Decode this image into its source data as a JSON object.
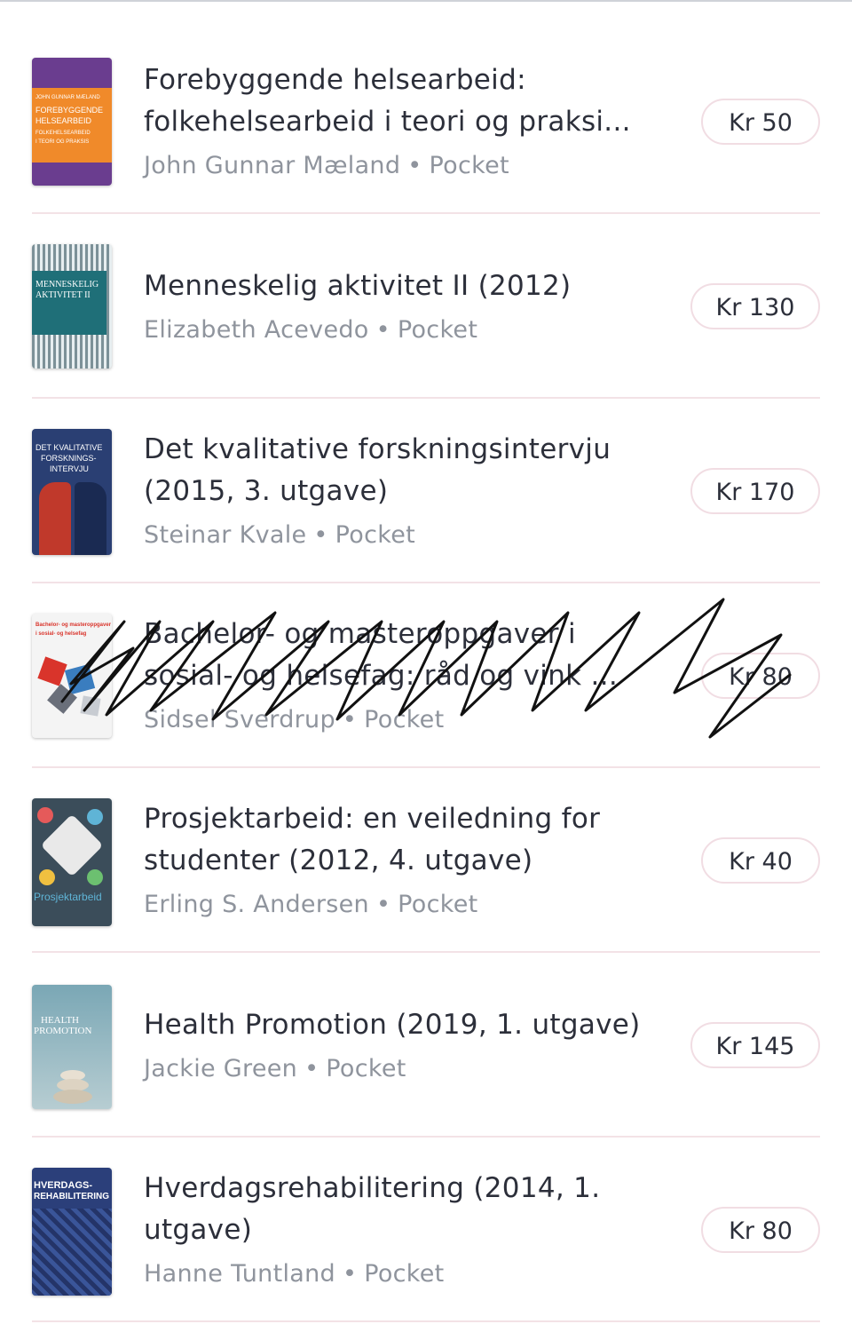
{
  "items": [
    {
      "title_lines": [
        "Forebyggende helsearbeid:",
        "folkehelsearbeid i teori og praksi..."
      ],
      "author": "John Gunnar Mæland",
      "format": "Pocket",
      "price": "Kr 50",
      "cover": {
        "bg": "#6a3d8f",
        "accent": "#f08a2a",
        "lines": [
          "JOHN GUNNAR MÆLAND",
          "FOREBYGGENDE",
          "HELSEARBEID",
          "FOLKEHELSEARBEID",
          "I TEORI OG PRAKSIS"
        ]
      }
    },
    {
      "title_lines": [
        "Menneskelig aktivitet II (2012)"
      ],
      "author": "Elizabeth Acevedo",
      "format": "Pocket",
      "price": "Kr 130",
      "cover": {
        "bg": "#1f6f78",
        "accent": "#ffffff",
        "lines": [
          "MENNESKELIG",
          "AKTIVITET II"
        ]
      }
    },
    {
      "title_lines": [
        "Det kvalitative forskningsintervju",
        "(2015, 3. utgave)"
      ],
      "author": "Steinar Kvale",
      "format": "Pocket",
      "price": "Kr 170",
      "cover": {
        "bg": "#2a3f73",
        "accent": "#c0392b",
        "lines": [
          "DET KVALITATIVE",
          "FORSKNINGS-",
          "INTERVJU"
        ]
      }
    },
    {
      "title_lines": [
        "Bachelor- og masteroppgaver i",
        "sosial- og helsefag: råd og vink ..."
      ],
      "author": "Sidsel Sverdrup",
      "format": "Pocket",
      "price": "Kr 80",
      "cover": {
        "bg": "#f4f4f4",
        "accent": "#d9342b",
        "lines": [
          "Bachelor- og masteroppgaver",
          "i sosial- og helsefag"
        ]
      }
    },
    {
      "title_lines": [
        "Prosjektarbeid: en veiledning for",
        "studenter (2012, 4. utgave)"
      ],
      "author": "Erling S. Andersen",
      "format": "Pocket",
      "price": "Kr 40",
      "cover": {
        "bg": "#3b4d5a",
        "accent": "#5fb4d6",
        "lines": [
          "Prosjektarbeid"
        ]
      }
    },
    {
      "title_lines": [
        "Health Promotion (2019, 1. utgave)"
      ],
      "author": "Jackie Green",
      "format": "Pocket",
      "price": "Kr 145",
      "cover": {
        "bg": "#7aa7b5",
        "accent": "#ffffff",
        "lines": [
          "HEALTH",
          "PROMOTION"
        ]
      }
    },
    {
      "title_lines": [
        "Hverdagsrehabilitering (2014, 1.",
        "utgave)"
      ],
      "author": "Hanne Tuntland",
      "format": "Pocket",
      "price": "Kr 80",
      "cover": {
        "bg": "#2b3f7a",
        "accent": "#ffffff",
        "lines": [
          "HVERDAGS-",
          "REHABILITERING"
        ]
      }
    }
  ],
  "separator_dot": "•"
}
